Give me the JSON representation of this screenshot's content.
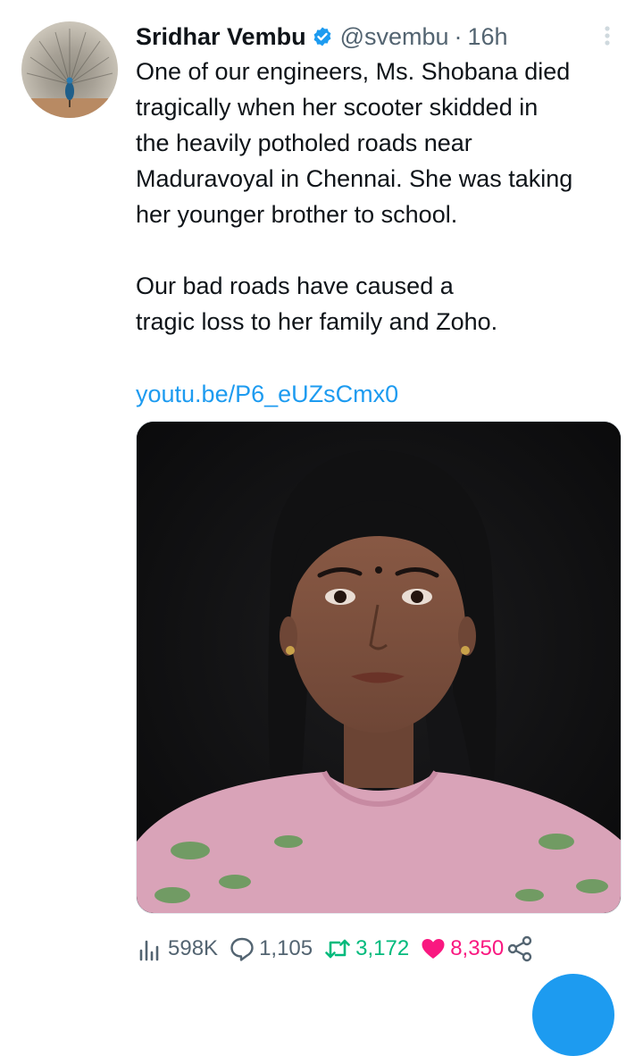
{
  "author": {
    "name": "Sridhar Vembu",
    "handle": "@svembu",
    "separator": "·",
    "time": "16h",
    "verified": true
  },
  "tweet": {
    "paragraphs": [
      "One of our engineers, Ms. Shobana died\ntragically when her scooter skidded in\nthe heavily potholed roads near\nMaduravoyal in Chennai. She was taking\nher younger brother to school.",
      "Our bad roads have caused a\ntragic loss to her family and Zoho."
    ],
    "link": "youtu.be/P6_eUZsCmx0"
  },
  "stats": {
    "views": "598K",
    "replies": "1,105",
    "retweets": "3,172",
    "likes": "8,350"
  },
  "icons": {
    "verified": "verified-badge-icon",
    "more": "more-vertical-icon",
    "views": "analytics-icon",
    "reply": "reply-icon",
    "retweet": "retweet-icon",
    "like": "heart-icon",
    "share": "share-icon"
  },
  "colors": {
    "accent": "#1d9bf0",
    "retweet": "#00ba7c",
    "like": "#f91880",
    "secondary_text": "#536471",
    "primary_text": "#0f1419"
  }
}
